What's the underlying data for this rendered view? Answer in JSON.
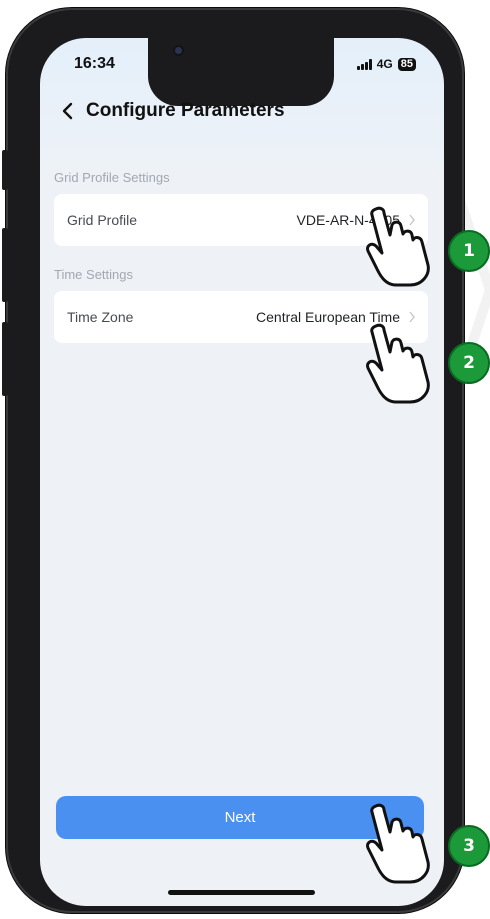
{
  "status_bar": {
    "time": "16:34",
    "network": "4G",
    "battery": "85"
  },
  "nav": {
    "title": "Configure Parameters"
  },
  "sections": [
    {
      "label": "Grid Profile Settings",
      "row_label": "Grid Profile",
      "row_value": "VDE-AR-N-4105"
    },
    {
      "label": "Time Settings",
      "row_label": "Time Zone",
      "row_value": "Central European Time"
    }
  ],
  "next_label": "Next",
  "step_markers": [
    "1",
    "2",
    "3"
  ],
  "colors": {
    "primary": "#4a90f0",
    "step_badge": "#1c9a3a"
  }
}
